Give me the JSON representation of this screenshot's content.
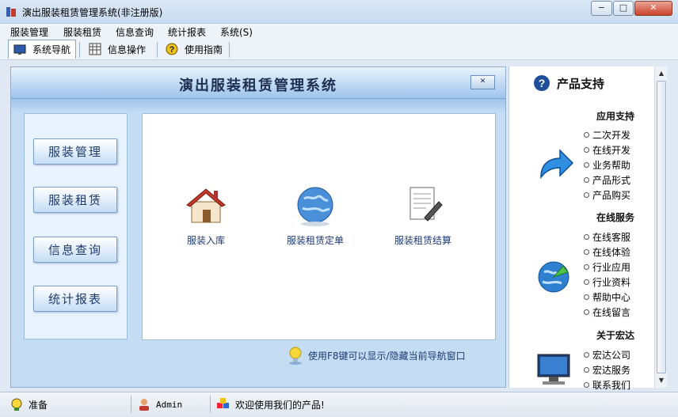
{
  "window": {
    "title": "演出服装租赁管理系统(非注册版)",
    "minimize": "−",
    "maximize": "□",
    "close": "✕"
  },
  "menu": [
    "服装管理",
    "服装租赁",
    "信息查询",
    "统计报表",
    "系统(S)"
  ],
  "toolbar": [
    {
      "label": "系统导航",
      "icon": "monitor-icon"
    },
    {
      "label": "信息操作",
      "icon": "grid-icon"
    },
    {
      "label": "使用指南",
      "icon": "help-icon"
    }
  ],
  "main": {
    "title": "演出服装租赁管理系统",
    "close_label": "✕",
    "left_buttons": [
      "服装管理",
      "服装租赁",
      "信息查询",
      "统计报表"
    ],
    "tiles": [
      {
        "label": "服装入库",
        "icon": "house-icon"
      },
      {
        "label": "服装租赁定单",
        "icon": "globe-icon"
      },
      {
        "label": "服装租赁结算",
        "icon": "document-pen-icon"
      }
    ],
    "tip": "使用F8键可以显示/隐藏当前导航窗口"
  },
  "side": {
    "heading": "产品支持",
    "sections": [
      {
        "title": "应用支持",
        "icon": "arrow-icon",
        "links": [
          "二次开发",
          "在线开发",
          "业务帮助",
          "产品形式",
          "产品购买"
        ]
      },
      {
        "title": "在线服务",
        "icon": "globe-arrow-icon",
        "links": [
          "在线客服",
          "在线体验",
          "行业应用",
          "行业资料",
          "帮助中心",
          "在线留言"
        ]
      },
      {
        "title": "关于宏达",
        "icon": "monitor-icon",
        "links": [
          "宏达公司",
          "宏达服务",
          "联系我们"
        ]
      }
    ]
  },
  "status": {
    "ready": "准备",
    "user": "Admin",
    "welcome": "欢迎使用我们的产品!"
  }
}
